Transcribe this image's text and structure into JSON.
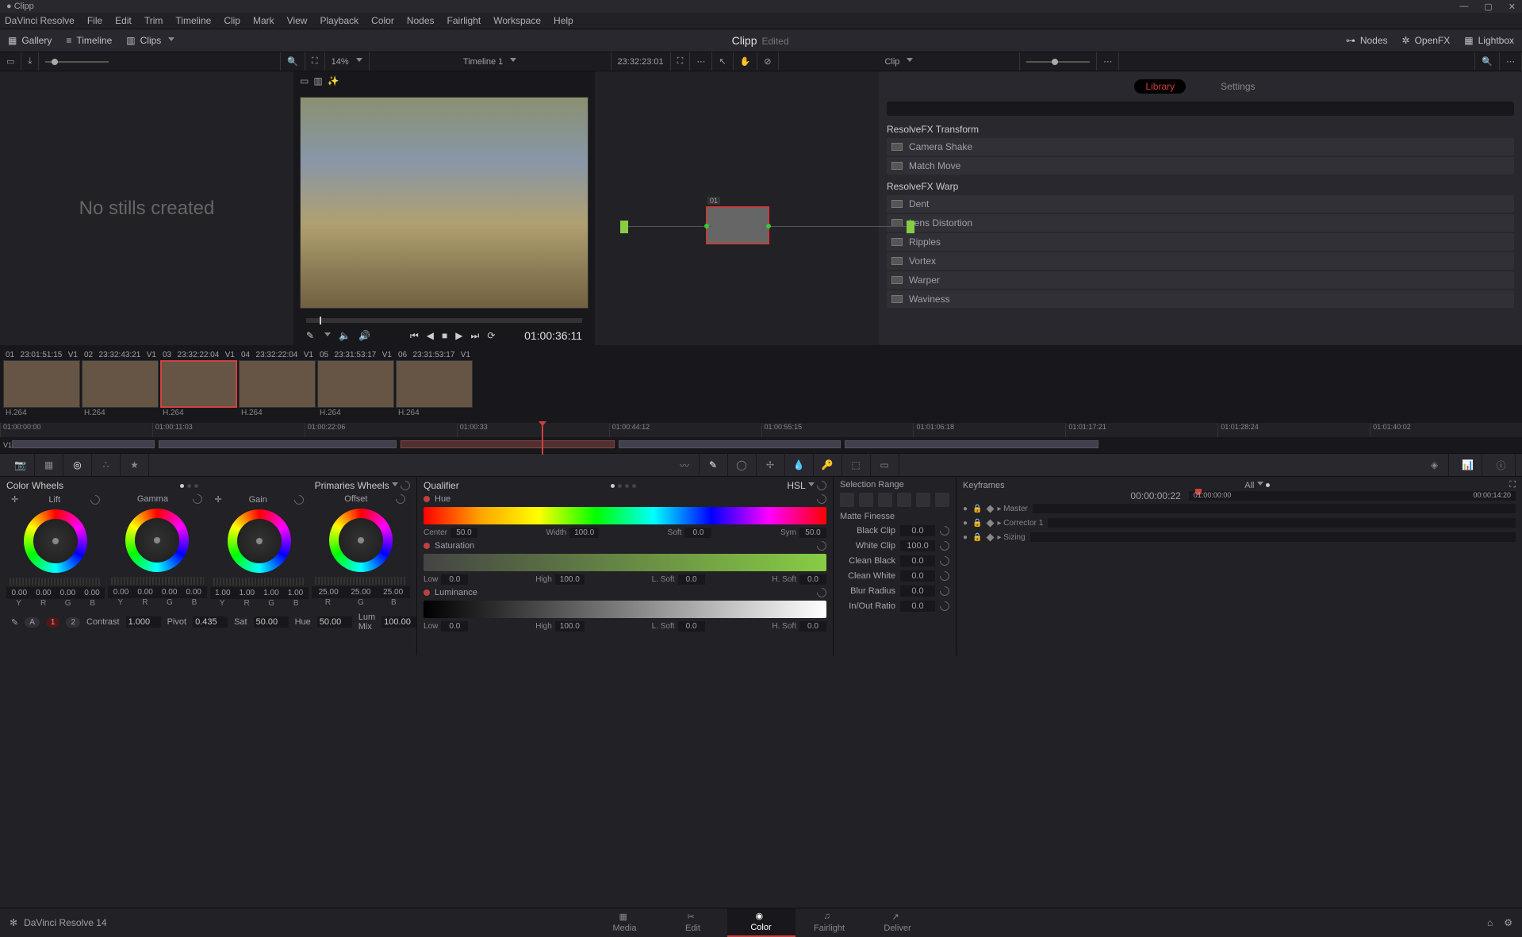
{
  "window": {
    "title": "Clipp"
  },
  "menubar": [
    "DaVinci Resolve",
    "File",
    "Edit",
    "Trim",
    "Timeline",
    "Clip",
    "Mark",
    "View",
    "Playback",
    "Color",
    "Nodes",
    "Fairlight",
    "Workspace",
    "Help"
  ],
  "toolbar": {
    "gallery": "Gallery",
    "timeline": "Timeline",
    "clips": "Clips",
    "project": "Clipp",
    "status": "Edited",
    "nodes": "Nodes",
    "openfx": "OpenFX",
    "lightbox": "Lightbox"
  },
  "row2": {
    "zoom": "14%",
    "timeline_name": "Timeline 1",
    "timeline_tc": "23:32:23:01",
    "clip_menu": "Clip"
  },
  "gallery_empty": "No stills created",
  "viewer": {
    "tc": "01:00:36:11"
  },
  "node": {
    "label": "01"
  },
  "fx": {
    "tabs": {
      "library": "Library",
      "settings": "Settings"
    },
    "groups": [
      {
        "title": "ResolveFX Transform",
        "items": [
          "Camera Shake",
          "Match Move"
        ]
      },
      {
        "title": "ResolveFX Warp",
        "items": [
          "Dent",
          "Lens Distortion",
          "Ripples",
          "Vortex",
          "Warper",
          "Waviness"
        ]
      }
    ]
  },
  "thumbs": [
    {
      "n": "01",
      "tc": "23:01:51:15",
      "track": "V1",
      "codec": "H.264",
      "sel": false
    },
    {
      "n": "02",
      "tc": "23:32:43:21",
      "track": "V1",
      "codec": "H.264",
      "sel": false
    },
    {
      "n": "03",
      "tc": "23:32:22:04",
      "track": "V1",
      "codec": "H.264",
      "sel": true
    },
    {
      "n": "04",
      "tc": "23:32:22:04",
      "track": "V1",
      "codec": "H.264",
      "sel": false
    },
    {
      "n": "05",
      "tc": "23:31:53:17",
      "track": "V1",
      "codec": "H.264",
      "sel": false
    },
    {
      "n": "06",
      "tc": "23:31:53:17",
      "track": "V1",
      "codec": "H.264",
      "sel": false
    }
  ],
  "ruler": [
    "01:00:00:00",
    "01:00:11:03",
    "01:00:22:06",
    "01:00:33",
    "01:00:44:12",
    "01:00:55:15",
    "01:01:06:18",
    "01:01:17:21",
    "01:01:28:24",
    "01:01:40:02"
  ],
  "track_label": "V1",
  "wheels": {
    "title": "Color Wheels",
    "mode": "Primaries Wheels",
    "cols": [
      {
        "name": "Lift",
        "vals": [
          "0.00",
          "0.00",
          "0.00",
          "0.00"
        ]
      },
      {
        "name": "Gamma",
        "vals": [
          "0.00",
          "0.00",
          "0.00",
          "0.00"
        ]
      },
      {
        "name": "Gain",
        "vals": [
          "1.00",
          "1.00",
          "1.00",
          "1.00"
        ]
      },
      {
        "name": "Offset",
        "vals": [
          "25.00",
          "25.00",
          "25.00"
        ]
      }
    ],
    "yrgb": [
      "Y",
      "R",
      "G",
      "B"
    ],
    "rgb": [
      "R",
      "G",
      "B"
    ],
    "adjust": {
      "contrast": "1.000",
      "pivot": "0.435",
      "sat": "50.00",
      "hue": "50.00",
      "lummix": "100.00"
    },
    "pills": [
      "1",
      "2"
    ]
  },
  "qualifier": {
    "title": "Qualifier",
    "mode": "HSL",
    "sections": [
      {
        "name": "Hue",
        "fields": [
          [
            "Center",
            "50.0"
          ],
          [
            "Width",
            "100.0"
          ],
          [
            "Soft",
            "0.0"
          ],
          [
            "Sym",
            "50.0"
          ]
        ]
      },
      {
        "name": "Saturation",
        "fields": [
          [
            "Low",
            "0.0"
          ],
          [
            "High",
            "100.0"
          ],
          [
            "L. Soft",
            "0.0"
          ],
          [
            "H. Soft",
            "0.0"
          ]
        ]
      },
      {
        "name": "Luminance",
        "fields": [
          [
            "Low",
            "0.0"
          ],
          [
            "High",
            "100.0"
          ],
          [
            "L. Soft",
            "0.0"
          ],
          [
            "H. Soft",
            "0.0"
          ]
        ]
      }
    ],
    "selrange": "Selection Range",
    "matte": "Matte Finesse",
    "matte_rows": [
      [
        "Black Clip",
        "0.0"
      ],
      [
        "White Clip",
        "100.0"
      ],
      [
        "Clean Black",
        "0.0"
      ],
      [
        "Clean White",
        "0.0"
      ],
      [
        "Blur Radius",
        "0.0"
      ],
      [
        "In/Out Ratio",
        "0.0"
      ]
    ]
  },
  "keyframes": {
    "title": "Keyframes",
    "filter": "All",
    "tc": "00:00:00:22",
    "range_start": "01:00:00:00",
    "range_end": "00:00:14:20",
    "tracks": [
      "Master",
      "Corrector 1",
      "Sizing"
    ]
  },
  "pages": [
    "Media",
    "Edit",
    "Color",
    "Fairlight",
    "Deliver"
  ],
  "footer": {
    "app": "DaVinci Resolve 14"
  }
}
